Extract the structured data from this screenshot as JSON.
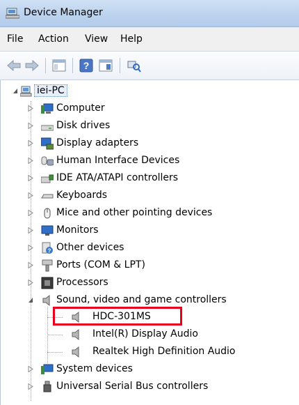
{
  "window": {
    "title": "Device Manager"
  },
  "menu": [
    "File",
    "Action",
    "View",
    "Help"
  ],
  "toolbar": {
    "buttons": [
      "back-arrow-icon",
      "forward-arrow-icon",
      "show-hide-console-tree-icon",
      "help-icon",
      "properties-icon",
      "scan-hardware-icon"
    ]
  },
  "tree": {
    "root": "iei-PC",
    "categories": [
      "Computer",
      "Disk drives",
      "Display adapters",
      "Human Interface Devices",
      "IDE ATA/ATAPI controllers",
      "Keyboards",
      "Mice and other pointing devices",
      "Monitors",
      "Other devices",
      "Ports (COM & LPT)",
      "Processors",
      "Sound, video and game controllers",
      "System devices",
      "Universal Serial Bus controllers"
    ],
    "sound_children": [
      "HDC-301MS",
      "Intel(R) Display Audio",
      "Realtek High Definition Audio"
    ]
  },
  "colors": {
    "highlight_box": "#e8001c",
    "title_bar": "#bcd3ee"
  }
}
